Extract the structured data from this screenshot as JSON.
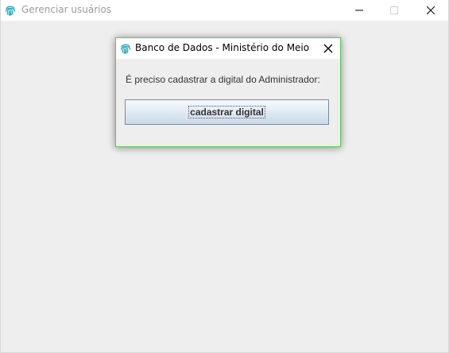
{
  "main_window": {
    "title": "Gerenciar usuários",
    "icon": "fingerprint-icon",
    "controls": {
      "minimize": "minimize-icon",
      "maximize": "maximize-icon",
      "close": "close-icon"
    }
  },
  "dialog": {
    "title": "Banco de Dados - Ministério do Meio A...",
    "icon": "fingerprint-icon",
    "close": "close-icon",
    "message": "É preciso cadastrar a digital do Administrador:",
    "action_label": "cadastrar digital"
  },
  "colors": {
    "window_background": "#eeeeee",
    "titlebar_background": "#ffffff",
    "dialog_border": "#5ac85a",
    "icon_teal": "#2aa6b5",
    "button_gradient_top": "#f4f8fc",
    "button_gradient_bottom": "#c9d9e9",
    "inactive_title_text": "#9b9b9b"
  }
}
